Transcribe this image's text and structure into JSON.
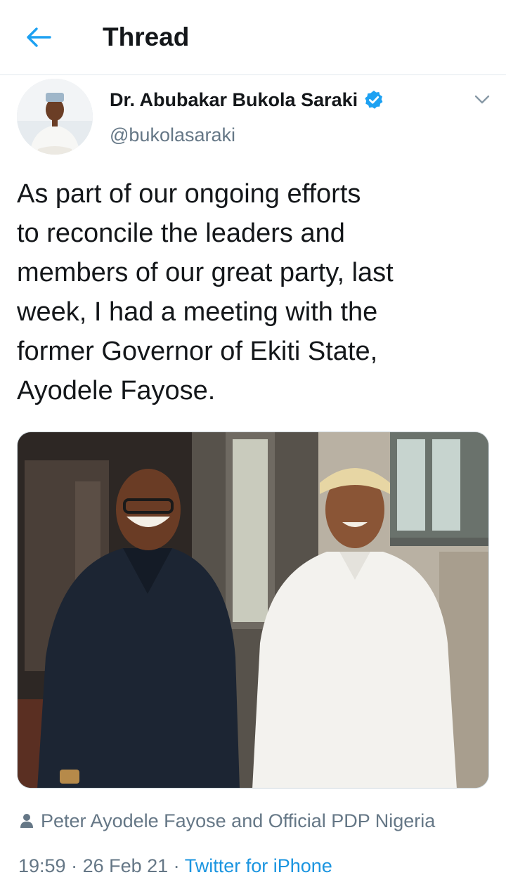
{
  "header": {
    "title": "Thread",
    "back_icon": "arrow-left-icon",
    "accent_color": "#1da1f2"
  },
  "tweet": {
    "author_name": "Dr. Abubakar Bukola Saraki",
    "handle": "@bukolasaraki",
    "verified_icon": "verified-badge-icon",
    "menu_icon": "chevron-down-icon",
    "text": "As part of our ongoing efforts\nto reconcile the leaders and\nmembers of our great party, last\nweek, I had a meeting with the\nformer Governor of Ekiti State,\nAyodele Fayose.",
    "tagged_icon": "person-icon",
    "tagged_text": "Peter Ayodele Fayose and Official PDP Nigeria",
    "time": "19:59",
    "separator": " · ",
    "date": "26 Feb 21",
    "source": "Twitter for iPhone",
    "source_color": "#1b95e0",
    "muted_color": "#657786"
  }
}
